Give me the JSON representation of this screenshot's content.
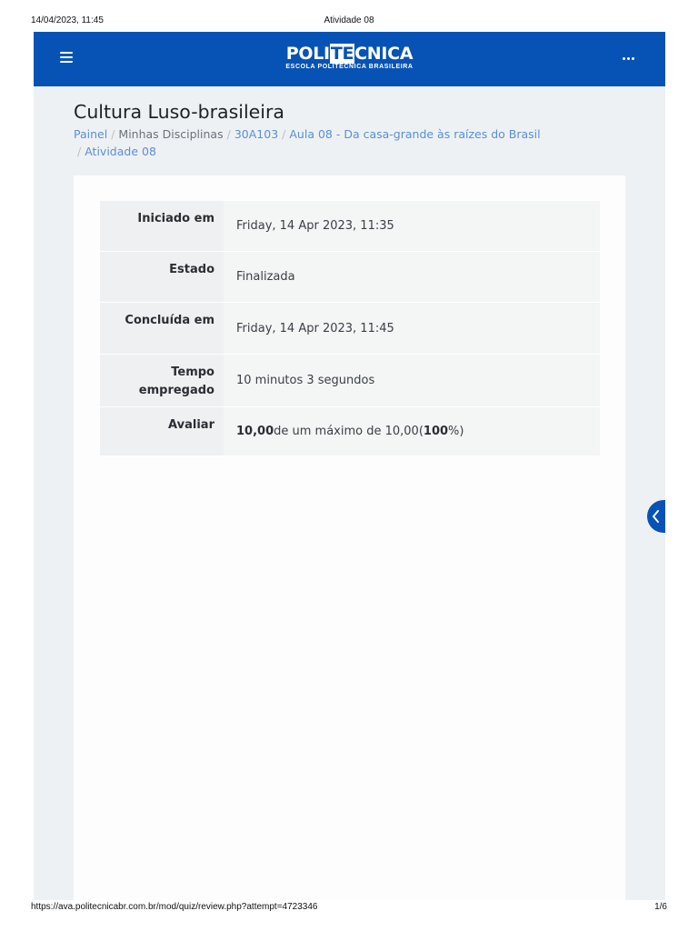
{
  "print": {
    "date": "14/04/2023, 11:45",
    "title": "Atividade 08",
    "url": "https://ava.politecnicabr.com.br/mod/quiz/review.php?attempt=4723346",
    "pages": "1/6"
  },
  "navbar": {
    "logo_pre": "POLI",
    "logo_hl": "TE",
    "logo_post": "CNICA",
    "logo_sub": "ESCOLA POLITÉCNICA BRASILEIRA",
    "menu_icon": "hamburger-icon",
    "more_icon": "more-horizontal-icon"
  },
  "page": {
    "title": "Cultura Luso-brasileira",
    "breadcrumb": [
      "Painel",
      "Minhas Disciplinas",
      "30A103",
      "Aula 08 - Da casa-grande às raízes do Brasil",
      "Atividade 08"
    ]
  },
  "summary": {
    "started_label": "Iniciado em",
    "started_value": "Friday, 14 Apr 2023, 11:35",
    "state_label": "Estado",
    "state_value": "Finalizada",
    "completed_label": "Concluída em",
    "completed_value": "Friday, 14 Apr 2023, 11:45",
    "time_label_1": "Tempo",
    "time_label_2": "empregado",
    "time_value": "10 minutos 3 segundos",
    "grade_label": "Avaliar",
    "grade_score": "10,00",
    "grade_mid": " de um máximo de 10,00(",
    "grade_percent": "100",
    "grade_end": "%)"
  },
  "drawer_icon": "chevron-left-icon",
  "colors": {
    "brand": "#0753b5",
    "link": "#5a8fd6"
  }
}
